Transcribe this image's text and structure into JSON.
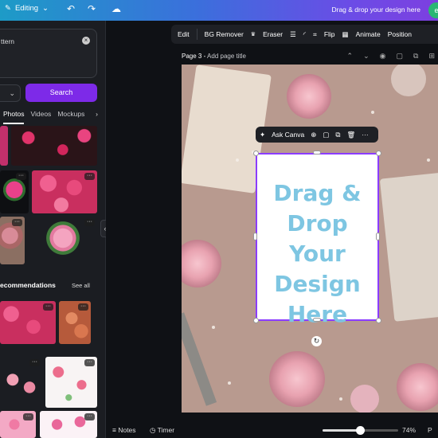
{
  "topbar": {
    "editing_label": "Editing",
    "drag_text": "Drag & drop your design here",
    "avatar_initial": "e"
  },
  "search": {
    "value": "ttern",
    "button_label": "Search"
  },
  "tabs": [
    "Photos",
    "Videos",
    "Mockups"
  ],
  "recommendations": {
    "title": "ecommendations",
    "see_all": "See all"
  },
  "toolbar": {
    "items": [
      "Edit",
      "BG Remover",
      "Eraser",
      "Flip",
      "Animate",
      "Position"
    ]
  },
  "page": {
    "label": "Page 3 -",
    "placeholder": "Add page title"
  },
  "context_menu": {
    "ask": "Ask Canva"
  },
  "frame": {
    "text": "Drag & Drop Your Design Here"
  },
  "bottom": {
    "notes": "Notes",
    "timer": "Timer",
    "zoom_value": 0.74,
    "zoom": "74%",
    "page_cut": "P"
  },
  "colors": {
    "brand": "#7d2ae8",
    "selection": "#8b3dff",
    "frame_text": "#7ec6e2"
  }
}
